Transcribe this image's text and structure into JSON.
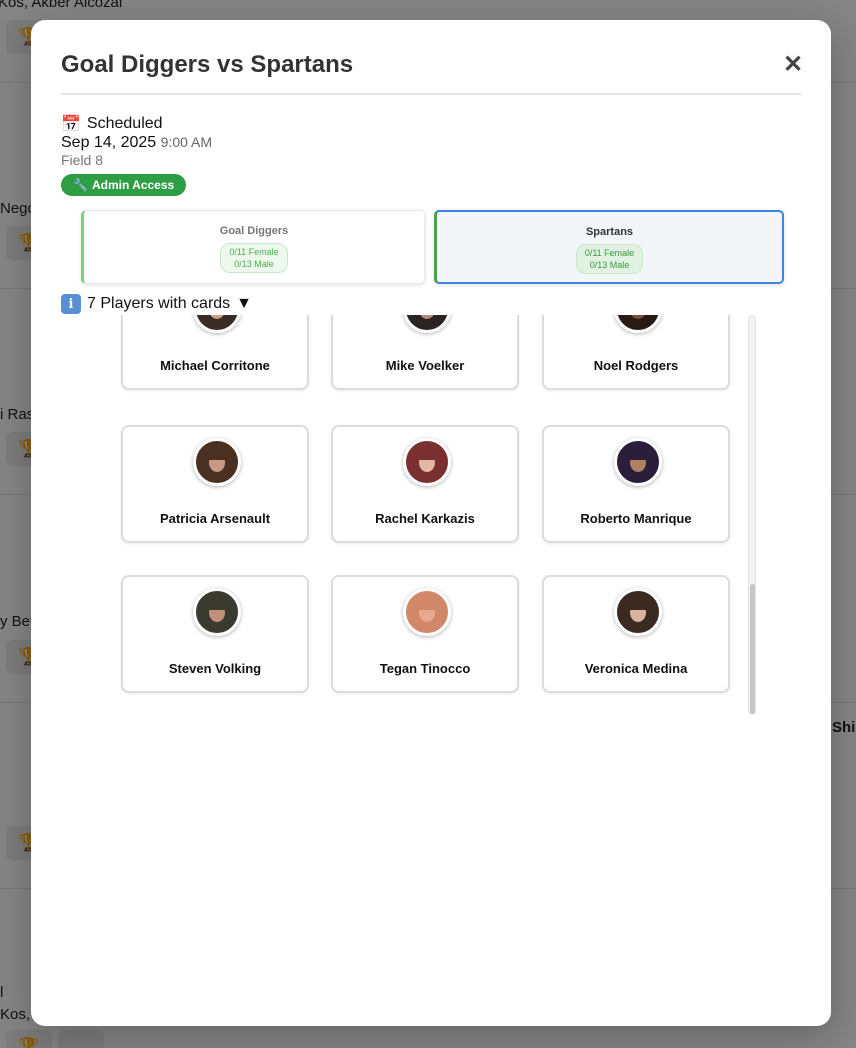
{
  "background": {
    "texts": [
      "Kos, Akber Alcozai",
      "Nego",
      "i Ras",
      "y Bet",
      "Shi",
      "l",
      "Kos, A"
    ],
    "trophy_icon": "trophy-icon"
  },
  "modal": {
    "title": "Goal Diggers vs Spartans",
    "close_symbol": "✕",
    "status_icon": "calendar-icon",
    "status_emoji": "📅",
    "status": "Scheduled",
    "date": "Sep 14, 2025",
    "time": "9:00 AM",
    "field": "Field 8",
    "admin_icon": "wrench-icon",
    "admin_emoji": "🔧",
    "admin_label": "Admin Access",
    "teams": [
      {
        "name": "Goal Diggers",
        "female": "0/11 Female",
        "male": "0/13 Male"
      },
      {
        "name": "Spartans",
        "female": "0/11 Female",
        "male": "0/13 Male"
      }
    ],
    "players_toggle": {
      "icon": "info-icon",
      "icon_glyph": "i",
      "label": "7 Players with cards",
      "caret": "▼"
    },
    "players": [
      {
        "name": "Michael Corritone",
        "skin": "#c9a08a",
        "hair": "#3a2d28"
      },
      {
        "name": "Mike Voelker",
        "skin": "#b58a78",
        "hair": "#2b2422"
      },
      {
        "name": "Noel Rodgers",
        "skin": "#7a5040",
        "hair": "#2a1a14"
      },
      {
        "name": "Patricia Arsenault",
        "skin": "#c89a84",
        "hair": "#4a3020"
      },
      {
        "name": "Rachel Karkazis",
        "skin": "#e0b8a4",
        "hair": "#7a3030"
      },
      {
        "name": "Roberto Manrique",
        "skin": "#b08060",
        "hair": "#2a1e3a"
      },
      {
        "name": "Steven Volking",
        "skin": "#c29078",
        "hair": "#3a3a30"
      },
      {
        "name": "Tegan Tinocco",
        "skin": "#e8a890",
        "hair": "#d08868"
      },
      {
        "name": "Veronica Medina",
        "skin": "#d8b4a0",
        "hair": "#3a2a22"
      }
    ]
  },
  "colors": {
    "admin_green": "#2e9e44",
    "selected_blue": "#3a86e0",
    "count_green": "#4ab04a"
  }
}
